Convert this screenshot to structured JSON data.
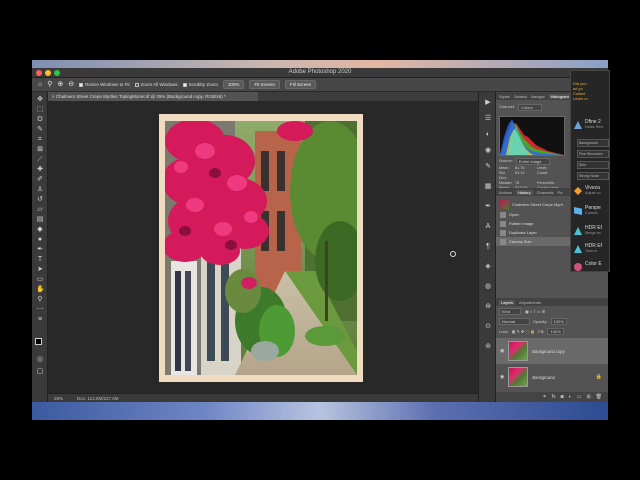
{
  "window": {
    "title": "Adobe Photoshop 2020"
  },
  "options_bar": {
    "resize_windows": "Resize Windows to Fit",
    "zoom_all": "Zoom All Windows",
    "scrubby": "Scrubby Zoom",
    "zoom_value": "100%",
    "fit_screen": "Fit Screen",
    "fill_screen": "Fill Screen"
  },
  "document": {
    "tab": "× Chalmers Street Crepe Myrtles ToplogMonet.tif @ 25% (Background copy, RGB/16) *"
  },
  "status": {
    "zoom": "25%",
    "doc": "Doc: 112.5M/227.0M"
  },
  "panel_top_tabs": [
    "Styles",
    "Swatch",
    "Navigat",
    "Histogram"
  ],
  "histogram": {
    "channel_label": "Channel:",
    "channel": "Colors",
    "source_label": "Source:",
    "source": "Entire Image",
    "stats": [
      [
        "Mean:",
        "81.76",
        "Level:",
        ""
      ],
      [
        "Std Dev:",
        "63.13",
        "Count:",
        ""
      ],
      [
        "Median:",
        "78",
        "Percentile:",
        ""
      ],
      [
        "Pixels:",
        "542216",
        "Cache Level:",
        ""
      ]
    ]
  },
  "history_tabs": [
    "Actions",
    "History",
    "Channels",
    "Pa"
  ],
  "history": {
    "snapshot": "Chalmers Street Crepe Myrtl",
    "items": [
      "Open",
      "Flatten Image",
      "Duplicate Layer",
      "Canvas Size"
    ]
  },
  "layers_tabs": [
    "Layers",
    "Adjustments"
  ],
  "layers": {
    "kind": "Kind",
    "blend": "Normal",
    "opacity_label": "Opacity:",
    "opacity": "100%",
    "lock_label": "Lock:",
    "fill_label": "Fill:",
    "fill": "100%",
    "rows": [
      "Background copy",
      "Background"
    ]
  },
  "plugin": {
    "header": [
      "Did you",
      "ad yo",
      "Collect",
      "Learn m"
    ],
    "items": [
      {
        "name": "Dfine 2",
        "sub": "Noise Red",
        "color": "#6fa0d8"
      },
      {
        "name": "Viveza",
        "sub": "Adjust co",
        "color": "#f0a030"
      },
      {
        "name": "Perspe",
        "sub": "Correct",
        "color": "#5ab0e8"
      },
      {
        "name": "HDR Ef",
        "sub": "Merge ex",
        "color": "#4fc0d0"
      },
      {
        "name": "HDR Ef",
        "sub": "Tone m",
        "color": "#4fc0d0"
      },
      {
        "name": "Color E",
        "sub": "",
        "color": "#d05080"
      }
    ],
    "dfine_opts": [
      "Background",
      "Fine Structures",
      "Skin",
      "Strong Noise"
    ]
  },
  "colors": {
    "accent": "#2f6fd0",
    "panel": "#535353",
    "chrome": "#3a3a3a"
  }
}
